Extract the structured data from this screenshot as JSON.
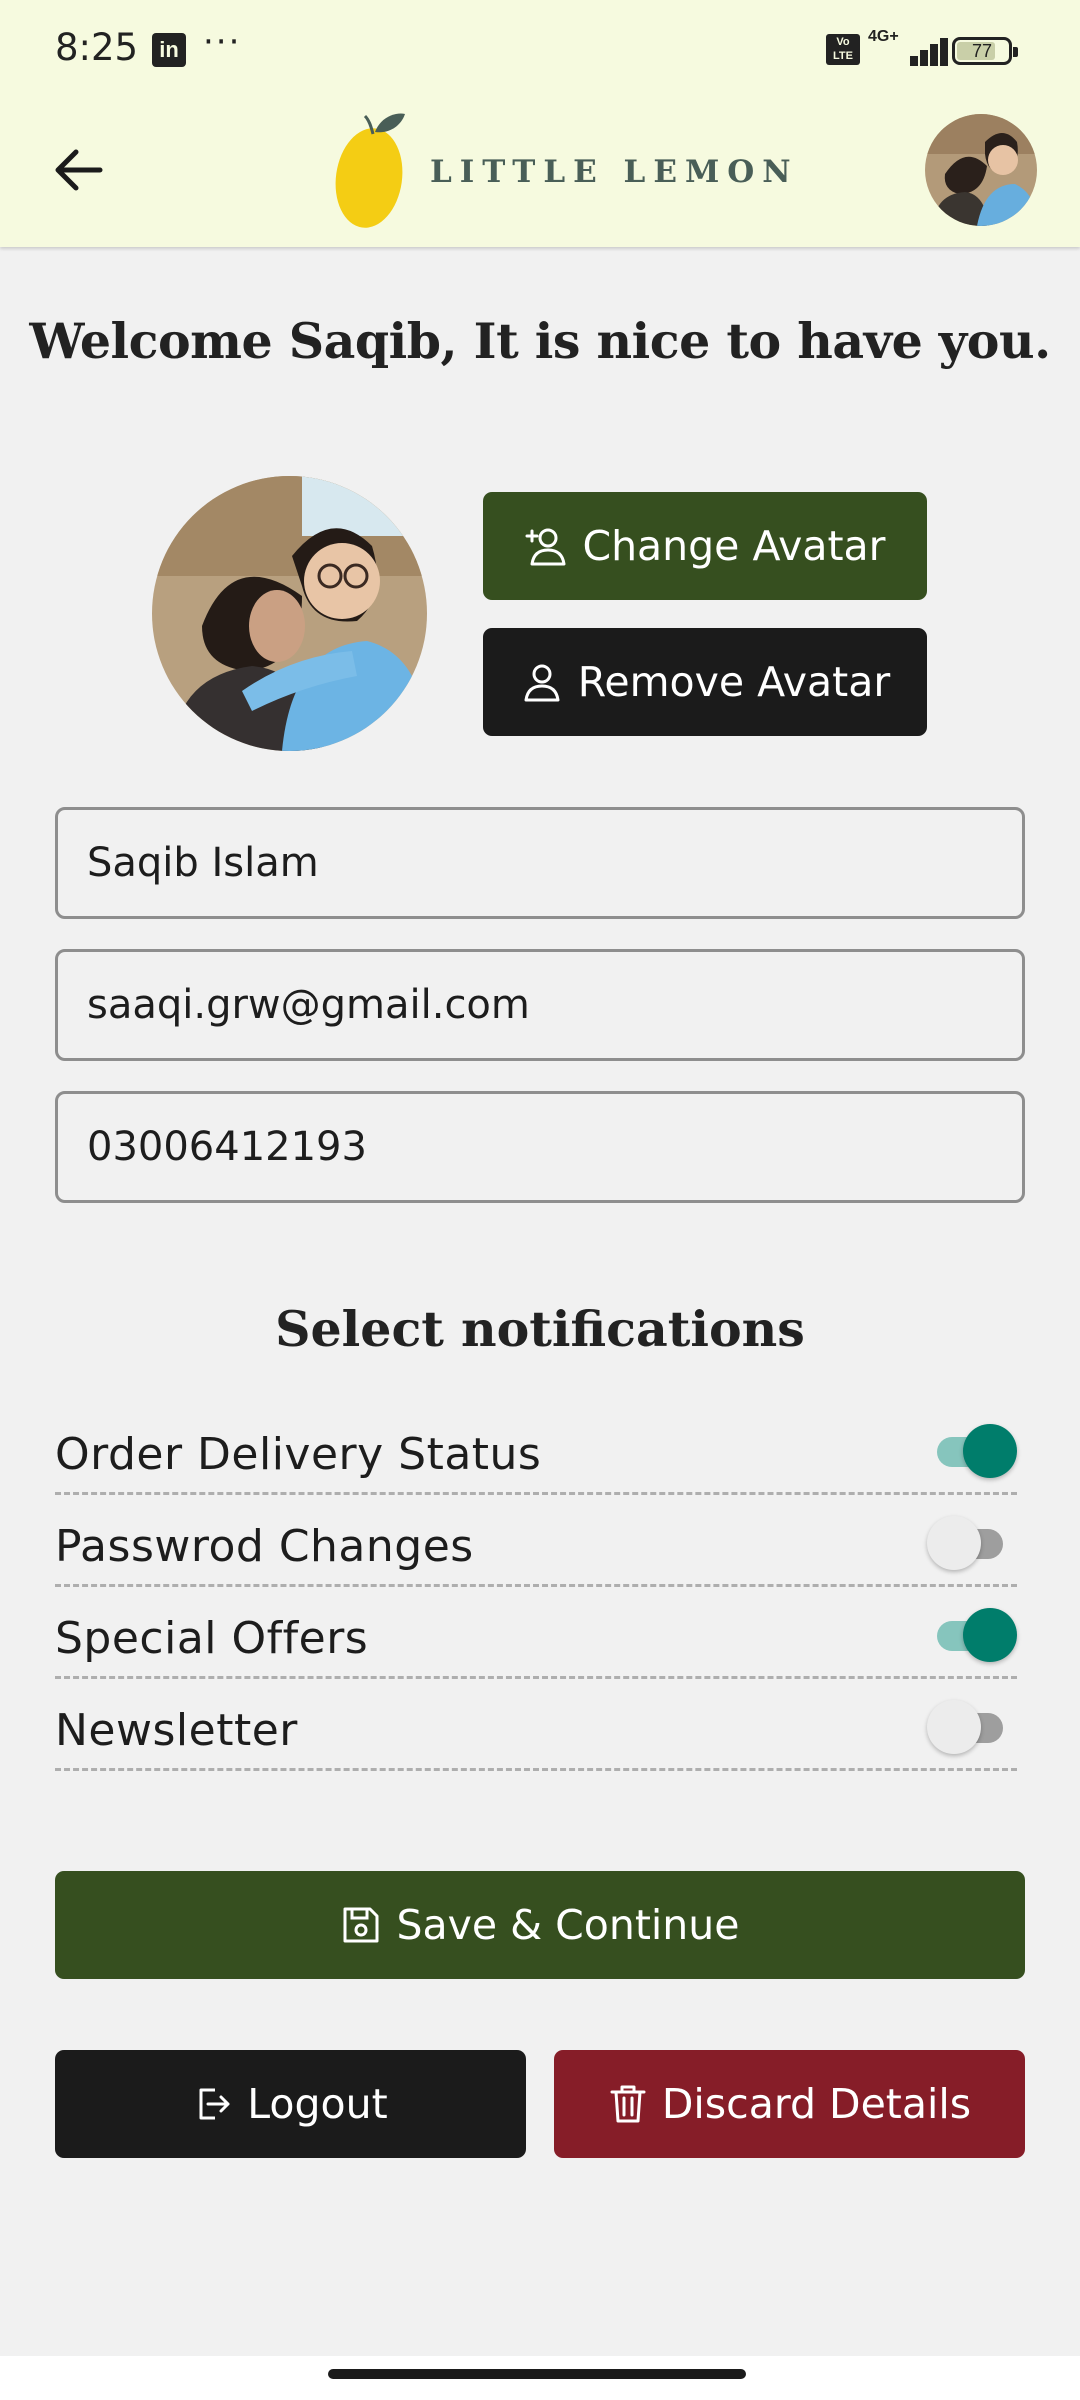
{
  "status_bar": {
    "time": "8:25",
    "notification_icons": [
      "linkedin-icon",
      "more-dots-icon"
    ],
    "linkedin_glyph": "in",
    "more_glyph": "···",
    "volte_label": "Vo\nLTE",
    "network": "4G+",
    "battery": "77"
  },
  "header": {
    "back_icon": "arrow-left-icon",
    "logo_text": "LITTLE LEMON",
    "avatar_icon": "user-photo"
  },
  "welcome_text": "Welcome Saqib, It is nice to have you.",
  "avatar_section": {
    "change_label": "Change Avatar",
    "change_icon": "user-plus-icon",
    "remove_label": "Remove Avatar",
    "remove_icon": "user-icon"
  },
  "form": {
    "name": "Saqib Islam",
    "email": "saaqi.grw@gmail.com",
    "phone": "03006412193"
  },
  "notifications": {
    "title": "Select notifications",
    "items": [
      {
        "label": "Order Delivery Status",
        "enabled": true
      },
      {
        "label": "Passwrod Changes",
        "enabled": false
      },
      {
        "label": "Special Offers",
        "enabled": true
      },
      {
        "label": "Newsletter",
        "enabled": false
      }
    ]
  },
  "actions": {
    "save_label": "Save & Continue",
    "save_icon": "floppy-disk-icon",
    "logout_label": "Logout",
    "logout_icon": "logout-icon",
    "discard_label": "Discard Details",
    "discard_icon": "trash-icon"
  },
  "colors": {
    "header_bg": "#f6fadf",
    "primary_green": "#364f1f",
    "dark": "#1b1b1b",
    "danger": "#861d28",
    "toggle_on": "#007d6b",
    "logo_text": "#495e57",
    "lemon_yellow": "#f4cd14"
  }
}
